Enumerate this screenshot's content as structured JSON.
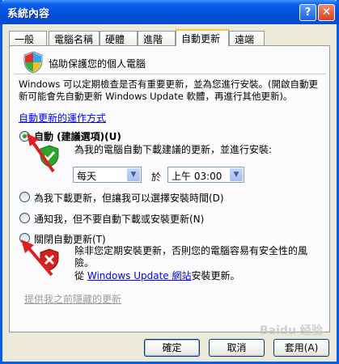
{
  "window": {
    "title": "系統內容"
  },
  "titlebar_buttons": {
    "help": "?",
    "close": "✕"
  },
  "tabs": [
    {
      "label": "一般"
    },
    {
      "label": "電腦名稱"
    },
    {
      "label": "硬體"
    },
    {
      "label": "進階"
    },
    {
      "label": "自動更新",
      "active": true
    },
    {
      "label": "遠端"
    }
  ],
  "header": {
    "title": "協助保護您的個人電腦"
  },
  "description": "Windows 可以定期檢查是否有重要更新，並為您進行安裝。(開啟自動更新可能會先自動更新 Windows Update 軟體，再進行其他更新)。",
  "how_link": "自動更新的運作方式",
  "options": {
    "auto": {
      "label": "自動 (建議選項)(U)",
      "sub": "為我的電腦自動下載建議的更新，並進行安裝:",
      "checked": true
    },
    "schedule": {
      "day": "每天",
      "at": "於",
      "time": "上午 03:00"
    },
    "download": {
      "label": "為我下載更新，但讓我可以選擇安裝時間(D)"
    },
    "notify": {
      "label": "通知我，但不要自動下載或安裝更新(N)"
    },
    "off": {
      "label": "關閉自動更新(T)",
      "warning": "除非您定期安裝更新，否則您的電腦容易有安全性的風險。",
      "from_prefix": "從",
      "from_link": "Windows Update 網站",
      "from_suffix": "安裝更新。"
    }
  },
  "hidden_link": "提供我之前隱藏的更新",
  "buttons": {
    "ok": "確定",
    "cancel": "取消",
    "apply": "套用(A)"
  },
  "watermark": "Baidu 经验",
  "colors": {
    "title_bar": "#0a5ee8",
    "dialog_bg": "#ece9d8",
    "annotation_arrow": "#e02020",
    "shield_green": "#2ba82b",
    "shield_red": "#d42020"
  }
}
